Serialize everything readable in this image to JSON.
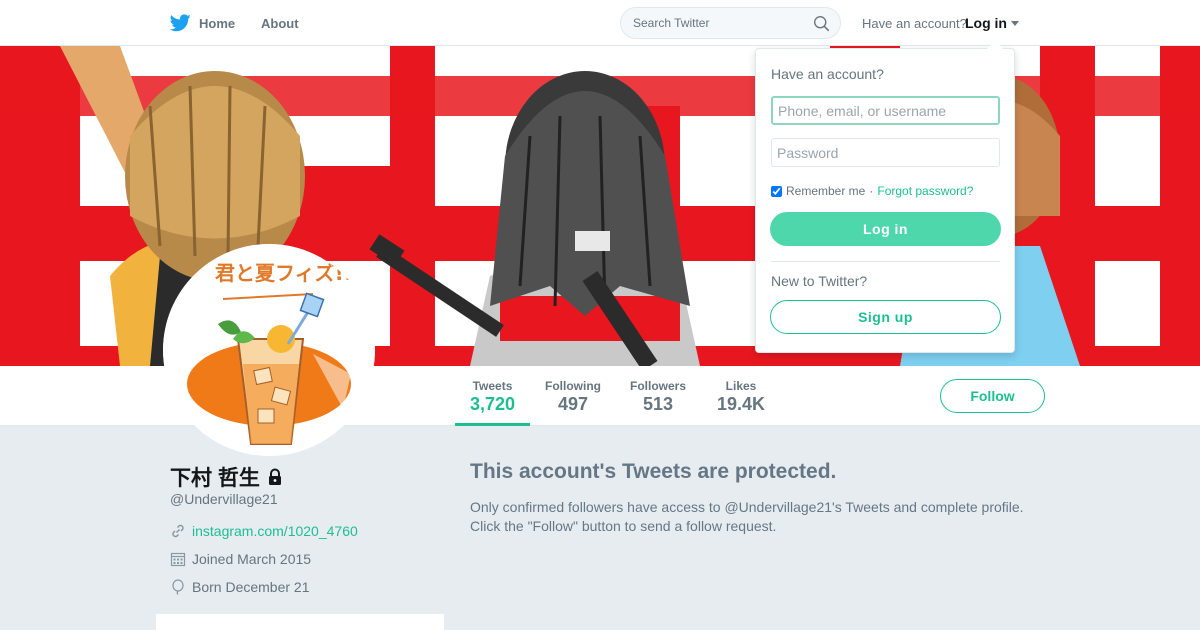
{
  "nav": {
    "home_label": "Home",
    "about_label": "About",
    "search_placeholder": "Search Twitter",
    "have_account": "Have an account?",
    "login_label": "Log in"
  },
  "profile": {
    "name": "下村 哲生",
    "screen_name": "@Undervillage21",
    "website": "instagram.com/1020_4760",
    "joined": "Joined March 2015",
    "born": "Born December 21",
    "avatar_text": "君と夏フィズ!!",
    "stats": [
      {
        "label": "Tweets",
        "value": "3,720"
      },
      {
        "label": "Following",
        "value": "497"
      },
      {
        "label": "Followers",
        "value": "513"
      },
      {
        "label": "Likes",
        "value": "19.4K"
      }
    ],
    "follow_label": "Follow"
  },
  "protected": {
    "title": "This account's Tweets are protected.",
    "text": "Only confirmed followers have access to @Undervillage21's Tweets and complete profile. Click the \"Follow\" button to send a follow request."
  },
  "login_dropdown": {
    "heading": "Have an account?",
    "username_placeholder": "Phone, email, or username",
    "password_placeholder": "Password",
    "remember_label": "Remember me",
    "separator": "·",
    "forgot_label": "Forgot password?",
    "login_button": "Log in",
    "new_heading": "New to Twitter?",
    "signup_button": "Sign up"
  },
  "colors": {
    "accent": "#1dbf92",
    "button_fill": "#4fd7ac",
    "banner_red": "#e8171f",
    "text_muted": "#66757f"
  },
  "icons": {
    "logo": "twitter-bird-icon",
    "search": "search-icon",
    "lock": "lock-icon",
    "link": "link-icon",
    "calendar": "calendar-icon",
    "balloon": "balloon-icon"
  }
}
